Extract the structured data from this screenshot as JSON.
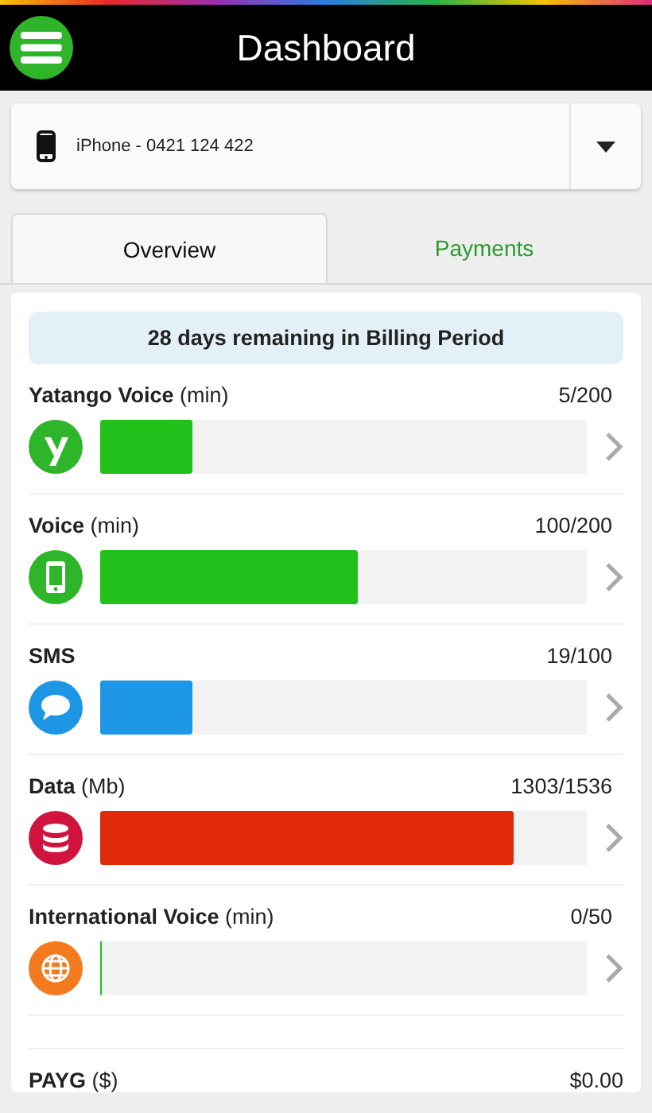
{
  "header": {
    "title": "Dashboard"
  },
  "device_select": {
    "value": "iPhone - 0421 124 422"
  },
  "tabs": [
    {
      "label": "Overview",
      "selected": true
    },
    {
      "label": "Payments",
      "selected": false
    }
  ],
  "billing_notice": "28 days remaining in Billing Period",
  "usage": [
    {
      "kind": "yatango",
      "name": "Yatango Voice",
      "unit": "(min)",
      "reading": "5/200",
      "level": 0.19,
      "color": "#22c01a"
    },
    {
      "kind": "phone",
      "name": "Voice",
      "unit": "(min)",
      "reading": "100/200",
      "level": 0.53,
      "color": "#22c01a"
    },
    {
      "kind": "chat",
      "name": "SMS",
      "reading": "19/100",
      "level": 0.19,
      "color": "#1e96e6"
    },
    {
      "kind": "database",
      "name": "Data",
      "unit": "(Mb)",
      "reading": "1303/1536",
      "level": 0.85,
      "color": "#e02a08"
    },
    {
      "kind": "globe",
      "name": "International Voice",
      "unit": "(min)",
      "reading": "0/50",
      "level": 0
    }
  ],
  "payg": {
    "name": "PAYG",
    "unit": "($)",
    "amount": "$0.00"
  }
}
